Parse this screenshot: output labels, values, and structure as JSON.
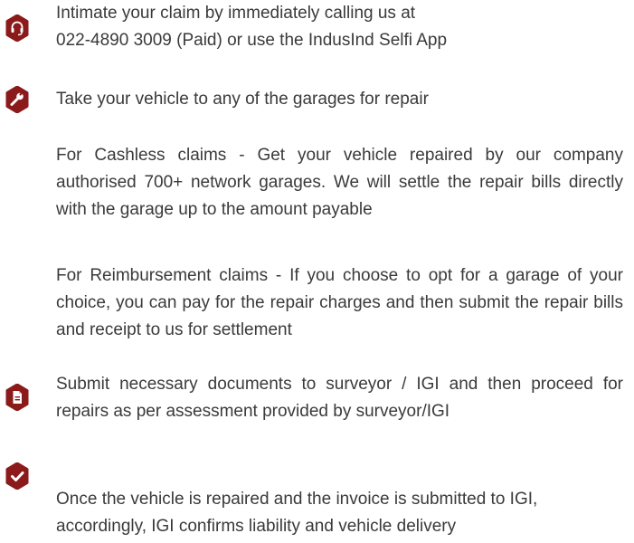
{
  "steps": [
    {
      "icon": "headset-icon",
      "lines": [
        "Intimate your claim by immediately calling us at",
        "022-4890 3009 (Paid) or use the IndusInd Selfi App"
      ]
    },
    {
      "icon": "wrench-icon",
      "text": "Take your vehicle to any of the garages for repair",
      "paragraphs": [
        "For Cashless claims - Get your vehicle repaired by our company authorised 700+ network garages. We will settle the repair bills directly with the garage up to the amount payable",
        "For Reimbursement claims - If you choose to opt for a garage of your choice, you can pay for the repair charges and then submit the repair bills and receipt to us for settlement"
      ]
    },
    {
      "icon": "document-icon",
      "text": "Submit necessary documents to surveyor / IGI and then proceed for repairs as per assessment provided by surveyor/IGI"
    },
    {
      "icon": "checkmark-icon",
      "text": "Once the vehicle is repaired and the invoice is submitted to IGI, accordingly, IGI confirms liability and vehicle delivery"
    }
  ],
  "colors": {
    "badge": "#8b1a1a",
    "text": "#3a3a3a"
  }
}
